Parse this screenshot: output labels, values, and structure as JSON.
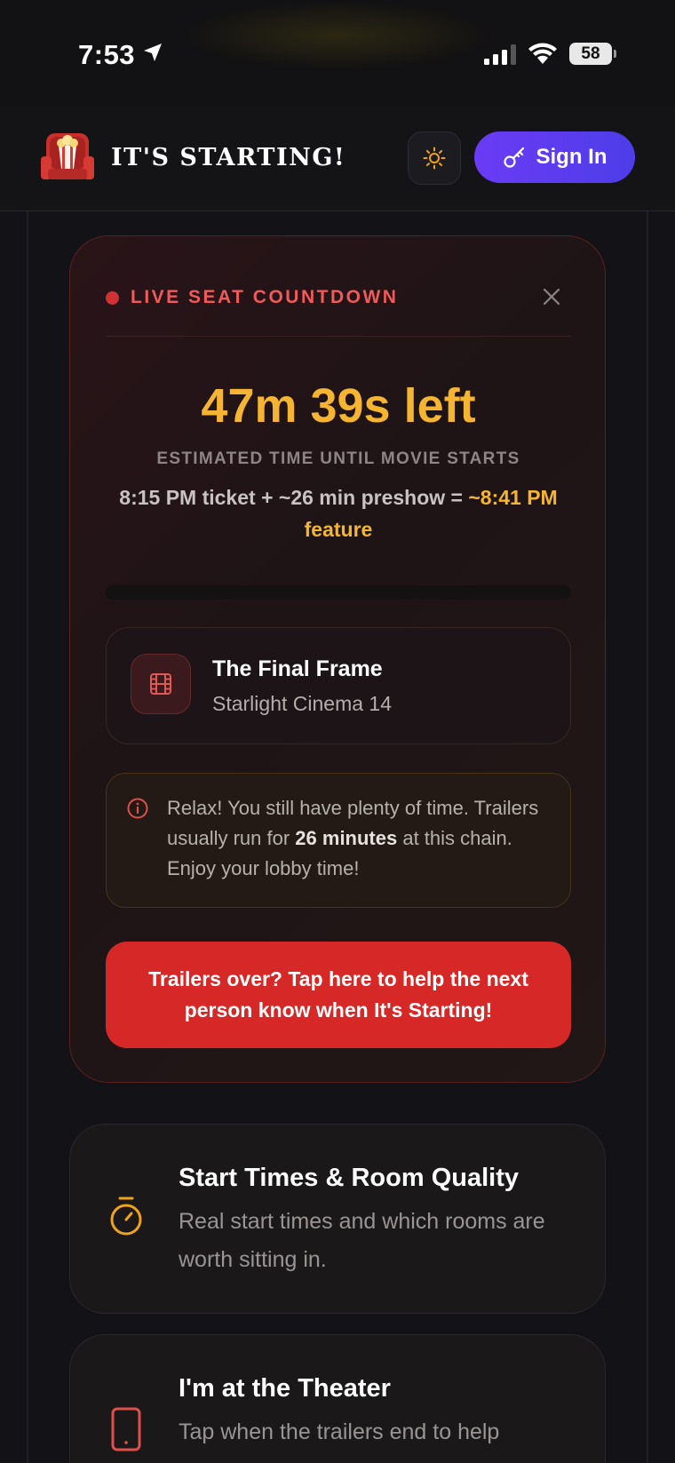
{
  "status_bar": {
    "time": "7:53",
    "battery": "58"
  },
  "header": {
    "brand": "IT'S STARTING!",
    "sign_in_label": "Sign In"
  },
  "countdown_card": {
    "live_label": "LIVE SEAT COUNTDOWN",
    "time_left": "47m 39s left",
    "estimate_label": "ESTIMATED TIME UNTIL MOVIE STARTS",
    "calc_prefix": "8:15 PM ticket + ~26 min preshow = ",
    "calc_feature": "~8:41 PM feature",
    "progress_fraction": 0.0,
    "movie_title": "The Final Frame",
    "theater_name": "Starlight Cinema 14",
    "info_prefix": "Relax! You still have plenty of time. Trailers usually run for ",
    "info_bold": "26 minutes",
    "info_suffix": " at this chain. Enjoy your lobby time!",
    "trailers_button": "Trailers over? Tap here to help the next person know when It's Starting!"
  },
  "features": [
    {
      "title": "Start Times & Room Quality",
      "description": "Real start times and which rooms are worth sitting in.",
      "icon": "stopwatch-icon"
    },
    {
      "title": "I'm at the Theater",
      "description": "Tap when the trailers end to help",
      "icon": "phone-icon"
    }
  ],
  "colors": {
    "accent_gold": "#f5b532",
    "accent_red": "#d62826",
    "sign_in_purple": "#5b3cf0"
  }
}
